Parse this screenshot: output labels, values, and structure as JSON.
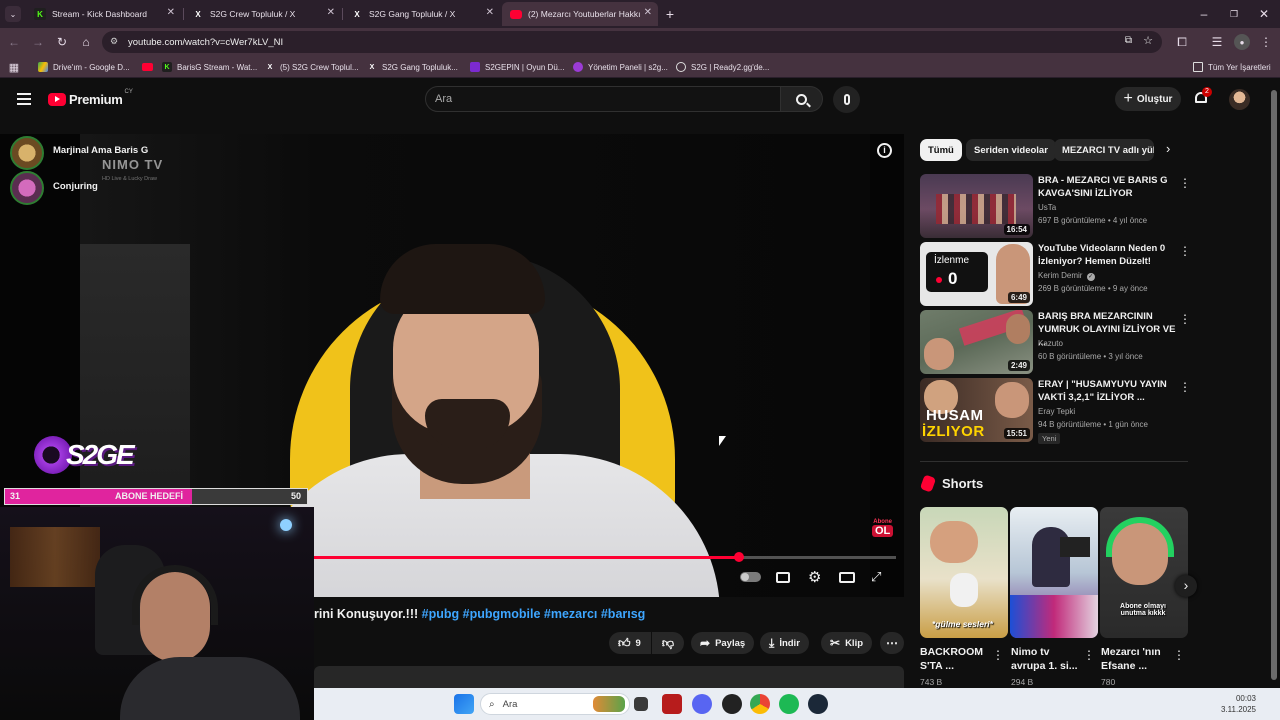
{
  "browser": {
    "tabs": [
      {
        "label": "Stream - Kick Dashboard",
        "active": false
      },
      {
        "label": "S2G Crew Topluluk / X",
        "active": false
      },
      {
        "label": "S2G Gang Topluluk / X",
        "active": false
      },
      {
        "label": "(2) Mezarcı Youtuberlar Hakkın",
        "active": true
      }
    ],
    "url": "youtube.com/watch?v=cWer7kLV_NI",
    "bookmarks": [
      "Drive'ım - Google D...",
      "BarisG Stream - Wat...",
      "(5) S2G Crew Toplul...",
      "S2G Gang Topluluk...",
      "S2GEPIN | Oyun Dü...",
      "Yönetim Paneli | s2g...",
      "S2G | Ready2.gg'de..."
    ],
    "all_bookmarks_label": "Tüm Yer İşaretleri"
  },
  "youtube": {
    "logo_text": "Premium",
    "logo_region": "CY",
    "search_placeholder": "Ara",
    "create_label": "Oluştur",
    "notification_count": "2"
  },
  "video": {
    "overlay_names": [
      "Marjinal Ama Baris G",
      "Conjuring"
    ],
    "watermark": "NIMO TV",
    "watermark_sub": "HD Live & Lucky Draw",
    "stream_logo": "S2GE",
    "goal_current": "31",
    "goal_label": "ABONE HEDEFİ",
    "goal_target": "50",
    "goal_progress": 0.62,
    "subscribe_sticker": [
      "Abone",
      "OL"
    ],
    "playback_progress": 0.73,
    "title_tail": "rini Konuşuyor.!!!",
    "hashtags": "#pubg #pubgmobile #mezarcı #barısg",
    "actions": {
      "likes": "9",
      "share": "Paylaş",
      "download": "İndir",
      "clip": "Klip"
    }
  },
  "sidebar": {
    "chips": [
      "Tümü",
      "Seriden videolar",
      "MEZARCI TV adlı yük"
    ],
    "recommendations": [
      {
        "title": "BRA - MEZARCI VE BARIS G KAVGA'SINI İZLİYOR",
        "channel": "UsTa",
        "meta": "697 B görüntüleme • 4 yıl önce",
        "duration": "16:54",
        "badge": "",
        "verified": false
      },
      {
        "title": "YouTube Videoların Neden 0 İzleniyor? Hemen Düzelt!",
        "channel": "Kerim Demir",
        "meta": "269 B görüntüleme • 9 ay önce",
        "duration": "6:49",
        "badge": "",
        "verified": true
      },
      {
        "title": "BARIŞ BRA MEZARCININ YUMRUK OLAYINI İZLİYOR VE ...",
        "channel": "Kazuto",
        "meta": "60 B görüntüleme • 3 yıl önce",
        "duration": "2:49",
        "badge": "",
        "verified": false
      },
      {
        "title": "ERAY | \"HUSAMYUYU YAYIN VAKTİ 3,2,1\" İZLİYOR ...",
        "channel": "Eray Tepki",
        "meta": "94 B görüntüleme • 1 gün önce",
        "duration": "15:51",
        "badge": "Yeni",
        "verified": false
      }
    ],
    "thumb_texts": {
      "izlenme": "İzlenme",
      "izlenme_num": "0",
      "husam": "HUSAM",
      "izliyor": "İZLIYOR"
    },
    "shorts_label": "Shorts",
    "shorts": [
      {
        "title": "BACKROOM S'TA ...",
        "views": "743 B",
        "caption": "*gülme sesleri*"
      },
      {
        "title": "Nimo tv avrupa 1. si...",
        "views": "294 B",
        "caption": ""
      },
      {
        "title": "Mezarcı 'nın Efsane ...",
        "views": "780",
        "caption": "Abone olmayı unutma kıkkk"
      }
    ]
  },
  "taskbar": {
    "search_label": "Ara",
    "time": "00:03",
    "date": "3.11.2025"
  },
  "colors": {
    "yt_red": "#ff0033",
    "goal_magenta": "#e0249e",
    "chair_yellow": "#f0c21a"
  }
}
